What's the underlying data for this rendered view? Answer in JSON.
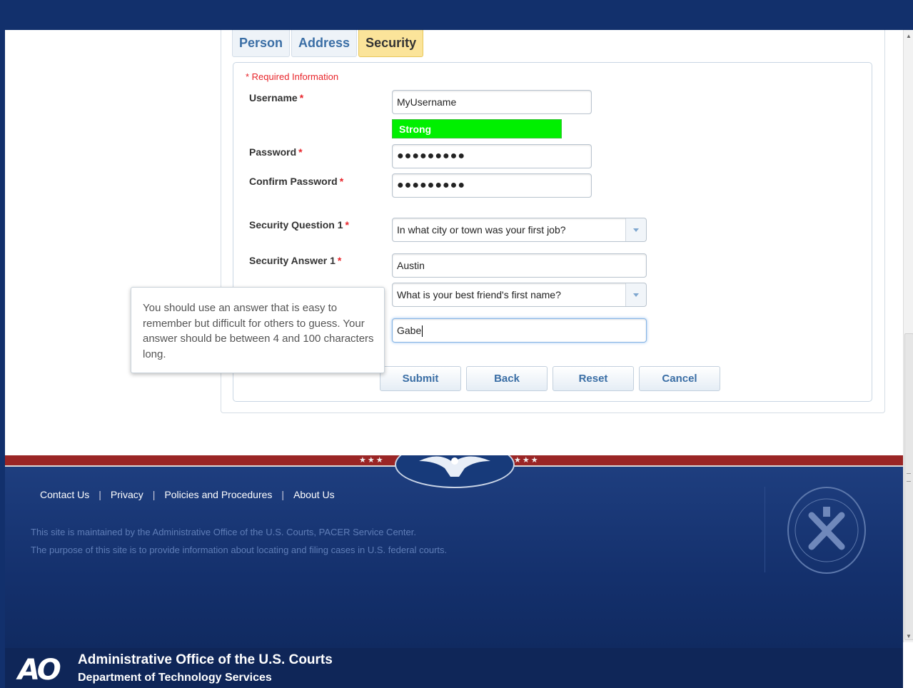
{
  "tabs": [
    {
      "label": "Person"
    },
    {
      "label": "Address"
    },
    {
      "label": "Security"
    }
  ],
  "form": {
    "required_note": "* Required Information",
    "username_label": "Username",
    "username_value": "MyUsername",
    "strength_text": "Strong",
    "password_label": "Password",
    "password_value": "●●●●●●●●●",
    "confirm_label": "Confirm Password",
    "confirm_value": "●●●●●●●●●",
    "sq1_label": "Security Question 1",
    "sq1_value": "In what city or town was your first job?",
    "sa1_label": "Security Answer 1",
    "sa1_value": "Austin",
    "sq2_value": "What is your best friend's first name?",
    "sa2_value": "Gabe",
    "required_star": "*"
  },
  "tooltip": {
    "text": "You should use an answer that is easy to remember but difficult for others to guess. Your answer should be between 4 and 100 characters long."
  },
  "buttons": {
    "submit": "Submit",
    "back": "Back",
    "reset": "Reset",
    "cancel": "Cancel"
  },
  "footer": {
    "links": [
      "Contact Us",
      "Privacy",
      "Policies and Procedures",
      "About Us"
    ],
    "separator": "|",
    "line1": "This site is maintained by the Administrative Office of the U.S. Courts, PACER Service Center.",
    "line2": "The purpose of this site is to provide information about locating and filing cases in U.S. federal courts.",
    "org_logo": "AO",
    "org_title": "Administrative Office of the U.S. Courts",
    "org_subtitle": "Department of Technology Services",
    "stars": "★★★"
  },
  "colors": {
    "strength_bar": "#00f000",
    "header_blue": "#12306c",
    "active_tab": "#fbe49a",
    "required_red": "#e8242a"
  }
}
